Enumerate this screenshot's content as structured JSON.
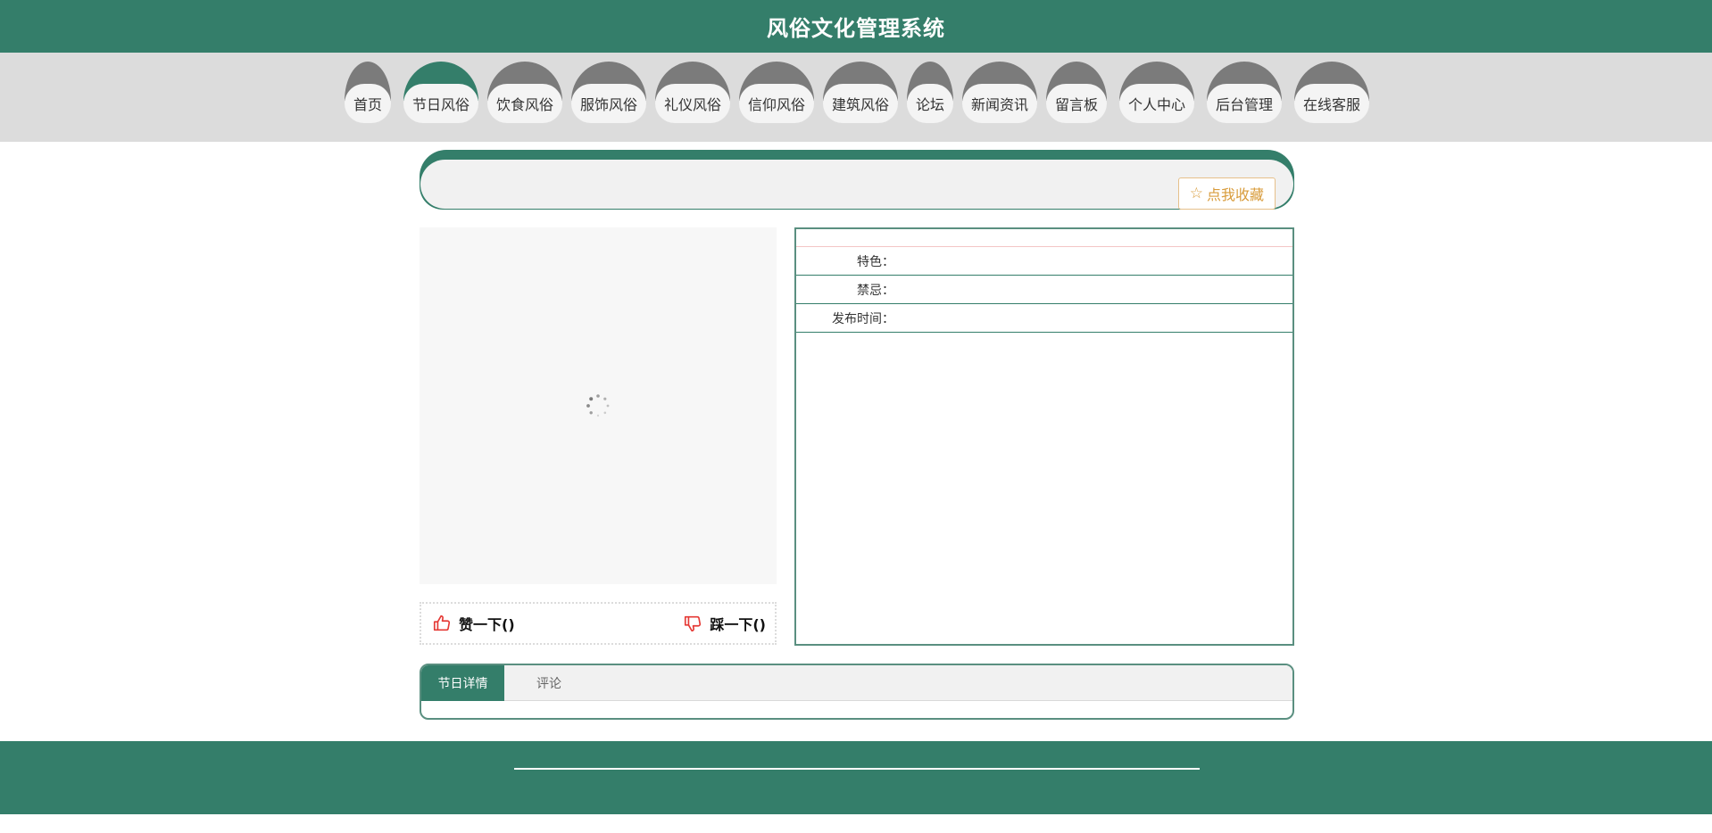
{
  "header": {
    "title": "风俗文化管理系统"
  },
  "nav": {
    "items": [
      {
        "label": "首页"
      },
      {
        "label": "节日风俗",
        "active": true
      },
      {
        "label": "饮食风俗"
      },
      {
        "label": "服饰风俗"
      },
      {
        "label": "礼仪风俗"
      },
      {
        "label": "信仰风俗"
      },
      {
        "label": "建筑风俗"
      },
      {
        "label": "论坛"
      },
      {
        "label": "新闻资讯"
      },
      {
        "label": "留言板"
      },
      {
        "label": "个人中心"
      },
      {
        "label": "后台管理"
      },
      {
        "label": "在线客服"
      }
    ]
  },
  "detail_header": {
    "favorite_label": "点我收藏",
    "favorite_icon": "star-outline-icon"
  },
  "votes": {
    "like_label": "赞一下()",
    "like_icon": "thumbs-up-icon",
    "dislike_label": "踩一下()",
    "dislike_icon": "thumbs-down-icon",
    "icon_color": "#e53935"
  },
  "details": {
    "rows": [
      {
        "label": "特色：",
        "value": ""
      },
      {
        "label": "禁忌：",
        "value": ""
      },
      {
        "label": "发布时间：",
        "value": ""
      }
    ]
  },
  "tabs": {
    "items": [
      {
        "label": "节日详情",
        "active": true
      },
      {
        "label": "评论"
      }
    ]
  },
  "colors": {
    "primary": "#347e6a",
    "nav_cap": "#7b7b7b",
    "nav_bg": "#dcdcdc",
    "favorite": "#d89b3a"
  }
}
